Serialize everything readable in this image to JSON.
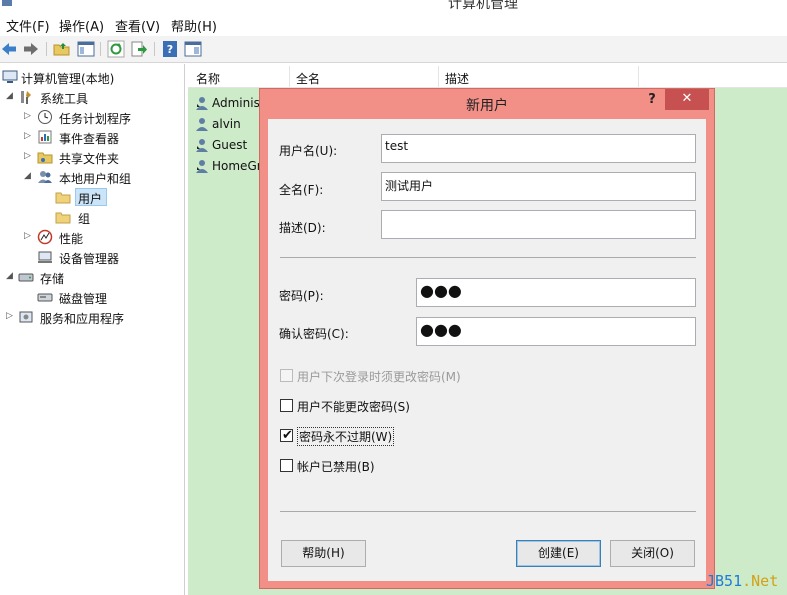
{
  "window": {
    "title": "计算机管理"
  },
  "menu": [
    {
      "label": "文件(F)"
    },
    {
      "label": "操作(A)"
    },
    {
      "label": "查看(V)"
    },
    {
      "label": "帮助(H)"
    }
  ],
  "toolbar": [
    "back-icon",
    "forward-icon",
    "up-folder-icon",
    "show-hide-tree-icon",
    "refresh-icon",
    "export-icon",
    "help-icon",
    "properties-icon"
  ],
  "tree": {
    "root": "计算机管理(本地)",
    "system_tools": "系统工具",
    "task_scheduler": "任务计划程序",
    "event_viewer": "事件查看器",
    "shared_folders": "共享文件夹",
    "local_users_groups": "本地用户和组",
    "users": "用户",
    "groups": "组",
    "performance": "性能",
    "device_manager": "设备管理器",
    "storage": "存储",
    "disk_management": "磁盘管理",
    "services_apps": "服务和应用程序"
  },
  "list": {
    "columns": [
      "名称",
      "全名",
      "描述"
    ],
    "rows": [
      {
        "name": "Administ"
      },
      {
        "name": "alvin"
      },
      {
        "name": "Guest"
      },
      {
        "name": "HomeGr"
      }
    ]
  },
  "dialog": {
    "title": "新用户",
    "help_glyph": "?",
    "close_glyph": "✕",
    "username_label": "用户名(U):",
    "username_value": "test",
    "fullname_label": "全名(F):",
    "fullname_value": "测试用户",
    "description_label": "描述(D):",
    "description_value": "",
    "password_label": "密码(P):",
    "password_value": "●●●",
    "confirm_label": "确认密码(C):",
    "confirm_value": "●●●",
    "options": [
      {
        "label": "用户下次登录时须更改密码(M)",
        "checked": false,
        "disabled": true
      },
      {
        "label": "用户不能更改密码(S)",
        "checked": false,
        "disabled": false
      },
      {
        "label": "密码永不过期(W)",
        "checked": true,
        "disabled": false
      },
      {
        "label": "帐户已禁用(B)",
        "checked": false,
        "disabled": false
      }
    ],
    "help_button": "帮助(H)",
    "create_button": "创建(E)",
    "close_button": "关闭(O)"
  },
  "watermark": {
    "jb": "JB51",
    "rest": ".Net"
  }
}
